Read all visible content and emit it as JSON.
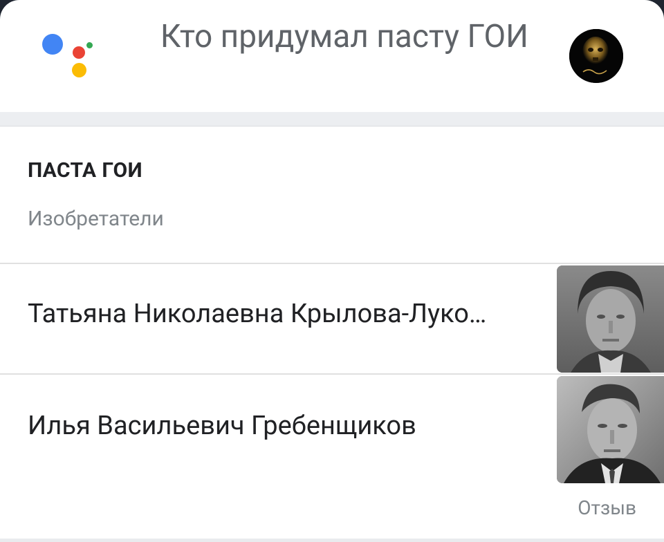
{
  "assistant": {
    "logo_icon": "google-assistant-dots-icon",
    "query": "Кто придумал пасту ГОИ",
    "user_avatar_icon": "user-avatar"
  },
  "result": {
    "title": "ПАСТА ГОИ",
    "subtitle": "Изобретатели",
    "inventors": [
      {
        "name": "Татьяна Николаевна Крылова-Луко…",
        "photo_icon": "portrait-woman"
      },
      {
        "name": "Илья Васильевич Гребенщиков",
        "photo_icon": "portrait-man"
      }
    ],
    "feedback_label": "Отзыв"
  },
  "colors": {
    "blue": "#4285f4",
    "red": "#ea4335",
    "yellow": "#fbbc05",
    "green": "#34a853",
    "text_primary": "#202124",
    "text_secondary": "#80868b"
  }
}
